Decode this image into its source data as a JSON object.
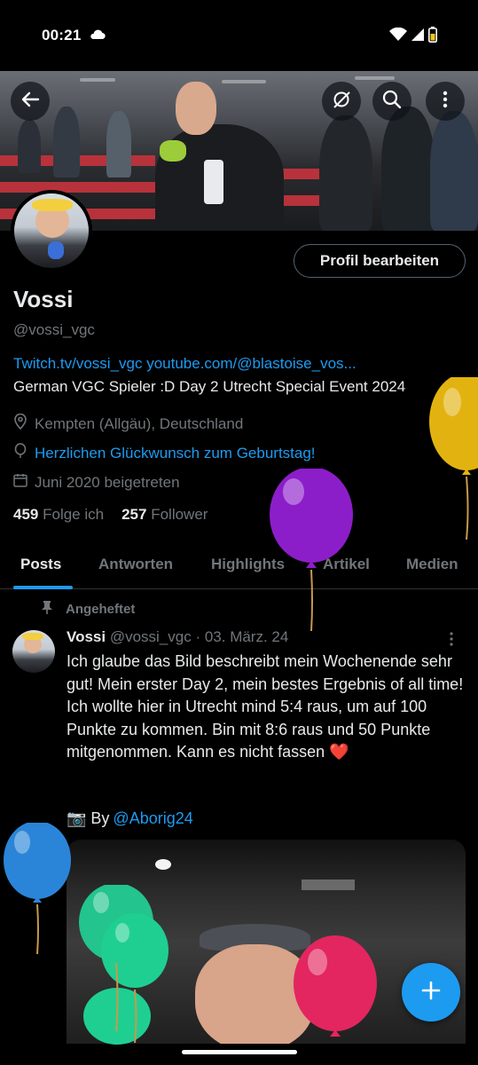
{
  "status_bar": {
    "time": "00:21"
  },
  "profile": {
    "edit_button": "Profil bearbeiten",
    "name": "Vossi",
    "handle": "@vossi_vgc",
    "bio_links": "Twitch.tv/vossi_vgc youtube.com/@blastoise_vos...",
    "bio_text": "German VGC Spieler :D  Day 2 Utrecht Special Event 2024",
    "location": "Kempten (Allgäu), Deutschland",
    "birthday": "Herzlichen Glückwunsch zum Geburtstag!",
    "joined": "Juni 2020 beigetreten",
    "following_count": "459",
    "following_label": "Folge ich",
    "followers_count": "257",
    "followers_label": "Follower"
  },
  "tabs": [
    {
      "label": "Posts"
    },
    {
      "label": "Antworten"
    },
    {
      "label": "Highlights"
    },
    {
      "label": "Artikel"
    },
    {
      "label": "Medien"
    }
  ],
  "post": {
    "pinned_label": "Angeheftet",
    "author_name": "Vossi",
    "meta": "@vossi_vgc · 03. März. 24",
    "text": "Ich glaube das Bild beschreibt mein Wochenende sehr gut! Mein erster Day 2, mein bestes Ergebnis of all time! Ich wollte hier in Utrecht mind 5:4 raus, um auf 100 Punkte zu kommen. Bin mit 8:6 raus und 50 Punkte mitgenommen. Kann es nicht fassen ❤️",
    "credit_prefix": "📷 By",
    "credit_link": "@Aborig24"
  },
  "colors": {
    "accent": "#1d9bf0",
    "text_primary": "#e7e9ea",
    "text_secondary": "#71767b",
    "background": "#000000"
  }
}
